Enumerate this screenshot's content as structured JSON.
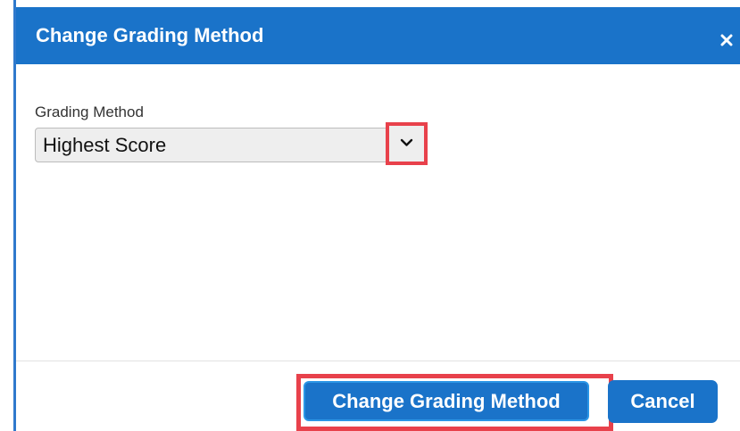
{
  "dialog": {
    "title": "Change Grading Method",
    "close_icon": "close-icon"
  },
  "form": {
    "grading_method": {
      "label": "Grading Method",
      "selected": "Highest Score",
      "arrow_icon": "chevron-down-icon"
    }
  },
  "footer": {
    "primary_label": "Change Grading Method",
    "cancel_label": "Cancel"
  },
  "colors": {
    "header_bg": "#1a73c9",
    "button_bg": "#1a73c9",
    "highlight": "#e8414b"
  }
}
